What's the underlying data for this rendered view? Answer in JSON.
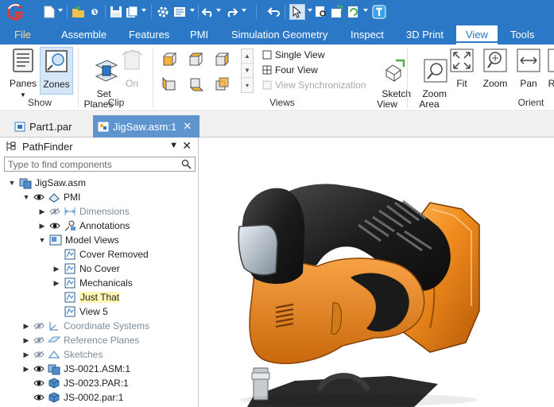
{
  "quick_access": {
    "icons": [
      "app-logo",
      "new-document-icon",
      "open-icon",
      "save-icon",
      "save-as-icon",
      "settings-icon",
      "properties-icon",
      "undo-icon",
      "redo-icon",
      "back-icon",
      "select-icon",
      "inspect-icon",
      "export-icon",
      "update-icon",
      "help-icon"
    ],
    "accent": "#2b78c6"
  },
  "ribbon_tabs": [
    {
      "label": "File"
    },
    {
      "label": "Assemble"
    },
    {
      "label": "Features"
    },
    {
      "label": "PMI"
    },
    {
      "label": "Simulation Geometry"
    },
    {
      "label": "Inspect"
    },
    {
      "label": "3D Print"
    },
    {
      "label": "View"
    },
    {
      "label": "Tools"
    }
  ],
  "active_tab": "View",
  "ribbon": {
    "show": {
      "label": "Show",
      "panes": "Panes",
      "zones": "Zones"
    },
    "clip": {
      "label": "Clip",
      "set_planes": "Set\nPlanes",
      "on": "On"
    },
    "views": {
      "label": "Views",
      "single_view": "Single View",
      "four_view": "Four View",
      "view_sync": "View Synchronization",
      "sketch_view": "Sketch\nView"
    },
    "orient": {
      "label": "Orient",
      "zoom_area": "Zoom\nArea",
      "fit": "Fit",
      "zoom": "Zoom",
      "pan": "Pan",
      "rotate": "R"
    }
  },
  "document_tabs": [
    {
      "label": "Part1.par",
      "active": false
    },
    {
      "label": "JigSaw.asm:1",
      "active": true
    }
  ],
  "pathfinder": {
    "title": "PathFinder",
    "search_placeholder": "Type to find components",
    "rows": [
      {
        "label": "JigSaw.asm",
        "icon": "assembly-icon"
      },
      {
        "label": "PMI",
        "icon": "pmi-icon"
      },
      {
        "label": "Dimensions",
        "icon": "dimensions-icon"
      },
      {
        "label": "Annotations",
        "icon": "annotations-icon"
      },
      {
        "label": "Model Views",
        "icon": "model-views-icon"
      },
      {
        "label": "Cover Removed",
        "icon": "model-view-icon"
      },
      {
        "label": "No Cover",
        "icon": "model-view-icon"
      },
      {
        "label": "Mechanicals",
        "icon": "model-view-icon"
      },
      {
        "label": "Just That",
        "icon": "model-view-icon"
      },
      {
        "label": "View 5",
        "icon": "model-view-icon"
      },
      {
        "label": "Coordinate Systems",
        "icon": "coordinate-system-icon"
      },
      {
        "label": "Reference Planes",
        "icon": "reference-plane-icon"
      },
      {
        "label": "Sketches",
        "icon": "sketch-icon"
      },
      {
        "label": "JS-0021.ASM:1",
        "icon": "subassembly-icon"
      },
      {
        "label": "JS-0023.PAR:1",
        "icon": "part-icon"
      },
      {
        "label": "JS-0002.par:1",
        "icon": "part-icon"
      }
    ]
  },
  "colors": {
    "ribbon_blue": "#2b78c6",
    "doc_tab_active": "#5f95cf",
    "jigsaw_orange": "#f08c1e",
    "jigsaw_black": "#1c1c1c",
    "highlight": "#fff8b5"
  }
}
